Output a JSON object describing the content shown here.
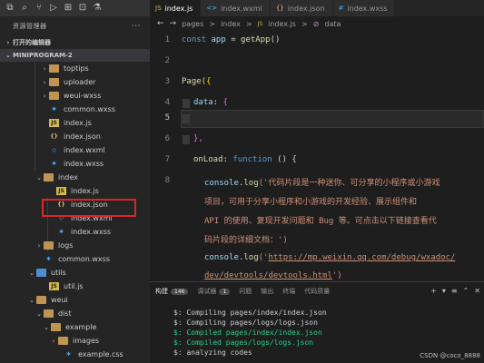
{
  "activity_icons": [
    "copy-icon",
    "search-icon",
    "source-control-icon",
    "debug-icon",
    "extensions-icon",
    "remote-icon",
    "lab-icon"
  ],
  "sidebar": {
    "title": "资源管理器",
    "more": "···",
    "open_editors": "打开的编辑器",
    "project": "MINIPROGRAM-2",
    "rows": [
      {
        "label": "toptips",
        "kind": "folder"
      },
      {
        "label": "uploader",
        "kind": "folder"
      },
      {
        "label": "weui-wxss",
        "kind": "folder"
      },
      {
        "label": "common.wxss",
        "kind": "wxss"
      },
      {
        "label": "index.js",
        "kind": "js"
      },
      {
        "label": "index.json",
        "kind": "json"
      },
      {
        "label": "index.wxml",
        "kind": "wxml"
      },
      {
        "label": "index.wxss",
        "kind": "wxss"
      },
      {
        "label": "index",
        "kind": "folder"
      },
      {
        "label": "index.js",
        "kind": "js"
      },
      {
        "label": "index.json",
        "kind": "json"
      },
      {
        "label": "index.wxml",
        "kind": "wxml"
      },
      {
        "label": "index.wxss",
        "kind": "wxss"
      },
      {
        "label": "logs",
        "kind": "folder"
      },
      {
        "label": "common.wxss",
        "kind": "wxss"
      },
      {
        "label": "utils",
        "kind": "folder"
      },
      {
        "label": "util.js",
        "kind": "js"
      },
      {
        "label": "weui",
        "kind": "folder"
      },
      {
        "label": "dist",
        "kind": "folder"
      },
      {
        "label": "example",
        "kind": "folder"
      },
      {
        "label": "images",
        "kind": "folder"
      },
      {
        "label": "example.css",
        "kind": "css"
      }
    ]
  },
  "tabs": [
    {
      "label": "index.js",
      "icon": "JS"
    },
    {
      "label": "index.wxml",
      "icon": "<>"
    },
    {
      "label": "index.json",
      "icon": "{}"
    },
    {
      "label": "index.wxss",
      "icon": "#"
    }
  ],
  "breadcrumb": {
    "back": "←",
    "forward": "→",
    "p1": "pages",
    "sep": ">",
    "p2": "index",
    "p3": "index.js",
    "p4": "data"
  },
  "code": {
    "line_numbers": [
      "1",
      "2",
      "3",
      "4",
      "5",
      "6",
      "7",
      "8"
    ],
    "l1_kw": "const",
    "l1_var": "app",
    "l1_eq": "=",
    "l1_fn": "getApp",
    "l1_paren": "()",
    "l3_fn": "Page",
    "l3_open": "({",
    "l4_prop": "data",
    "l4_colon": ":",
    "l4_brace": "{",
    "l6_close": "},",
    "l7_prop": "onLoad",
    "l7_colon": ":",
    "l7_kw": "function",
    "l7_rest": "() {",
    "l8_obj": "console",
    "l8_fn": "log",
    "l8_str": "('代码片段是一种迷你、可分享的小程序或小游戏",
    "l8_wrap1": "项目，可用于分享小程序和小游戏的开发经验、展示组件和",
    "l8_wrap2": "API 的使用、复现开发问题和 Bug 等。可点击以下链接查看代",
    "l8_wrap3": "码片段的详细文档：')",
    "l9_obj": "console",
    "l9_fn": "log",
    "l9_open": "('",
    "l9_url": "https://mp.weixin.qq.com/debug/wxadoc/",
    "l9_wrap": "dev/devtools/devtools.html",
    "l9_close": "')"
  },
  "panel": {
    "tabs": [
      {
        "label": "构建",
        "badge": "146"
      },
      {
        "label": "调试器",
        "badge": "1"
      },
      {
        "label": "问题",
        "badge": ""
      },
      {
        "label": "输出",
        "badge": ""
      },
      {
        "label": "终端",
        "badge": ""
      },
      {
        "label": "代码质量",
        "badge": ""
      }
    ],
    "actions": [
      "+",
      "▾",
      "≡",
      "⌃",
      "✕"
    ],
    "output": [
      {
        "text": "$: Compiling pages/index/index.json",
        "color": "white"
      },
      {
        "text": "$: Compiling pages/logs/logs.json",
        "color": "white"
      },
      {
        "text": "$: Compiled pages/index/index.json",
        "color": "green"
      },
      {
        "text": "$: Compiled pages/logs/logs.json",
        "color": "green"
      },
      {
        "text": "$: analyzing codes",
        "color": "white"
      }
    ],
    "watermark": "CSDN @coco_8888"
  }
}
